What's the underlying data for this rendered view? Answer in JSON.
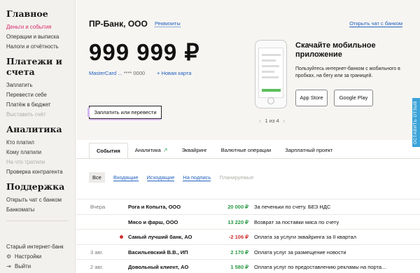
{
  "sidebar": {
    "sections": [
      {
        "title": "Главное",
        "items": [
          {
            "label": "Деньги и события",
            "state": "active"
          },
          {
            "label": "Операции и выписка",
            "state": "normal"
          },
          {
            "label": "Налоги и отчётность",
            "state": "normal"
          }
        ]
      },
      {
        "title": "Платежи и счета",
        "items": [
          {
            "label": "Заплатить",
            "state": "normal"
          },
          {
            "label": "Перевести себе",
            "state": "normal"
          },
          {
            "label": "Платёж в бюджет",
            "state": "normal"
          },
          {
            "label": "Выставить счёт",
            "state": "dim"
          }
        ]
      },
      {
        "title": "Аналитика",
        "items": [
          {
            "label": "Кто платил",
            "state": "normal"
          },
          {
            "label": "Кому платили",
            "state": "normal"
          },
          {
            "label": "На что тратили",
            "state": "dim"
          },
          {
            "label": "Проверка контрагента",
            "state": "normal"
          }
        ]
      },
      {
        "title": "Поддержка",
        "items": [
          {
            "label": "Открыть чат с банком",
            "state": "normal"
          },
          {
            "label": "Банкоматы",
            "state": "normal"
          }
        ]
      }
    ],
    "bottom": [
      {
        "label": "Старый интернет-банк",
        "icon": ""
      },
      {
        "label": "Настройки",
        "icon": "gear-icon"
      },
      {
        "label": "Выйти",
        "icon": "logout-icon"
      }
    ]
  },
  "header": {
    "bank_name": "ПР-Банк, ООО",
    "requisites": "Реквизиты",
    "open_chat": "Открыть чат с банком",
    "balance": "999 999 ₽",
    "card_link": "MasterCard ...",
    "card_number": "**** 0000",
    "new_card": "+ Новая карта",
    "transfer_button": "Заплатить или перевести"
  },
  "promo": {
    "title": "Скачайте мобильное приложение",
    "text": "Пользуйтесь интернет-банком с мобильного в пробках, на бегу или за границей.",
    "app_store": "App Store",
    "google_play": "Google Play",
    "pager": "1 из 4",
    "prev": "‹",
    "next": "›"
  },
  "tabs": [
    {
      "label": "События",
      "active": true,
      "trend": ""
    },
    {
      "label": "Аналитика",
      "active": false,
      "trend": "↗"
    },
    {
      "label": "Эквайринг",
      "active": false,
      "trend": ""
    },
    {
      "label": "Валютные операции",
      "active": false,
      "trend": ""
    },
    {
      "label": "Зарплатный проект",
      "active": false,
      "trend": ""
    }
  ],
  "filters": [
    {
      "label": "Все",
      "kind": "all"
    },
    {
      "label": "Входящие",
      "kind": "link"
    },
    {
      "label": "Исходящие",
      "kind": "link"
    },
    {
      "label": "На подпись",
      "kind": "link"
    },
    {
      "label": "Планируемые",
      "kind": "dim"
    }
  ],
  "rows": [
    {
      "date": "Вчера",
      "name": "Рога и Копыта, ООО",
      "amount": "20 000 ₽",
      "sign": "pos",
      "purpose": "За печеньки по счету. БЕЗ НДС",
      "dot": ""
    },
    {
      "date": "",
      "name": "Мясо и фарш, ООО",
      "amount": "13 220 ₽",
      "sign": "pos",
      "purpose": "Возврат за поставки мяса по счету",
      "dot": ""
    },
    {
      "date": "",
      "name": "Самый лучший банк, АО",
      "amount": "-2 106 ₽",
      "sign": "neg",
      "purpose": "Оплата за услуги эквайринга за II квартал",
      "dot": "#d03030"
    },
    {
      "date": "3 авг.",
      "name": "Васильевский В.В., ИП",
      "amount": "2 170 ₽",
      "sign": "pos",
      "purpose": "Оплата услуг за размещение новости",
      "dot": ""
    },
    {
      "date": "2 авг.",
      "name": "Довольный клиент, АО",
      "amount": "1 580 ₽",
      "sign": "pos",
      "purpose": "Оплата услуг по предоставлению рекламы на порта...",
      "dot": ""
    }
  ],
  "feedback": "ОСТАВИТЬ ОТЗЫВ",
  "colors": {
    "accent": "#d92c6e",
    "link": "#1f5fbf",
    "positive": "#2a9a45",
    "negative": "#d03030",
    "feedback": "#3ba3d8"
  }
}
